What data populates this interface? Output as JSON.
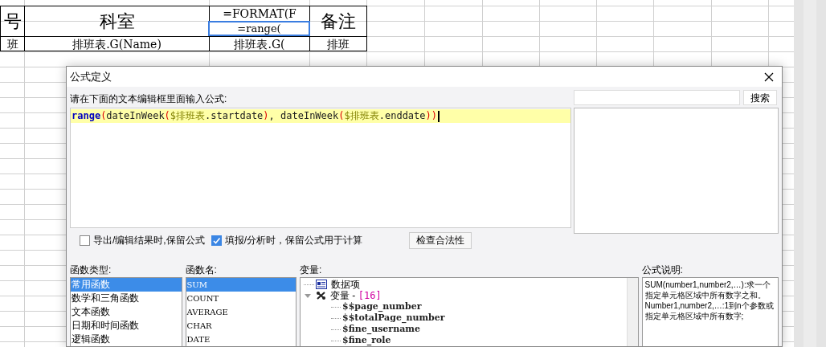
{
  "sheet": {
    "rows": [
      [
        "号",
        "科室",
        "=FORMAT(F",
        "备注"
      ],
      [
        "班",
        "排班表.G(Name)",
        "排班表.G(",
        "排班"
      ]
    ],
    "selected_cell": {
      "text": "=range("
    }
  },
  "dialog": {
    "title": "公式定义",
    "prompt": "请在下面的文本编辑框里面输入公式:",
    "formula": [
      {
        "kind": "function",
        "text": "range"
      },
      {
        "kind": "paren",
        "text": "("
      },
      {
        "kind": "plain",
        "text": "dateInWeek"
      },
      {
        "kind": "paren",
        "text": "("
      },
      {
        "kind": "variable",
        "text": "$排班表"
      },
      {
        "kind": "plain",
        "text": ".startdate"
      },
      {
        "kind": "paren",
        "text": ")"
      },
      {
        "kind": "plain",
        "text": ", dateInWeek"
      },
      {
        "kind": "paren",
        "text": "("
      },
      {
        "kind": "variable",
        "text": "$排班表"
      },
      {
        "kind": "plain",
        "text": ".enddate"
      },
      {
        "kind": "paren",
        "text": "))"
      }
    ],
    "search_button": "搜索",
    "options": [
      {
        "label": "导出/编辑结果时,保留公式",
        "checked": false
      },
      {
        "label": "填报/分析时，保留公式用于计算",
        "checked": true
      }
    ],
    "check_button": "检查合法性",
    "function_types": {
      "label": "函数类型:",
      "items": [
        {
          "text": "常用函数",
          "selected": true
        },
        {
          "text": "数学和三角函数",
          "selected": false
        },
        {
          "text": "文本函数",
          "selected": false
        },
        {
          "text": "日期和时间函数",
          "selected": false
        },
        {
          "text": "逻辑函数",
          "selected": false
        }
      ]
    },
    "function_names": {
      "label": "函数名:",
      "items": [
        {
          "text": "SUM",
          "selected": true
        },
        {
          "text": "COUNT",
          "selected": false
        },
        {
          "text": "AVERAGE",
          "selected": false
        },
        {
          "text": "CHAR",
          "selected": false
        },
        {
          "text": "DATE",
          "selected": false
        }
      ]
    },
    "variables": {
      "label": "变量:",
      "tree": [
        {
          "text": "数据项",
          "kind": "data"
        },
        {
          "text": "变量 - ",
          "count": "[16]",
          "kind": "group",
          "expanded": true,
          "children": [
            {
              "text": "$$page_number"
            },
            {
              "text": "$$totalPage_number"
            },
            {
              "text": "$fine_username"
            },
            {
              "text": "$fine_role"
            }
          ]
        }
      ]
    },
    "description": {
      "label": "公式说明:",
      "text": "SUM(number1,number2,…):求一个指定单元格区域中所有数字之和。",
      "text2": "Number1,number2,…:1到n个参数或指定单元格区域中所有数字;"
    }
  }
}
